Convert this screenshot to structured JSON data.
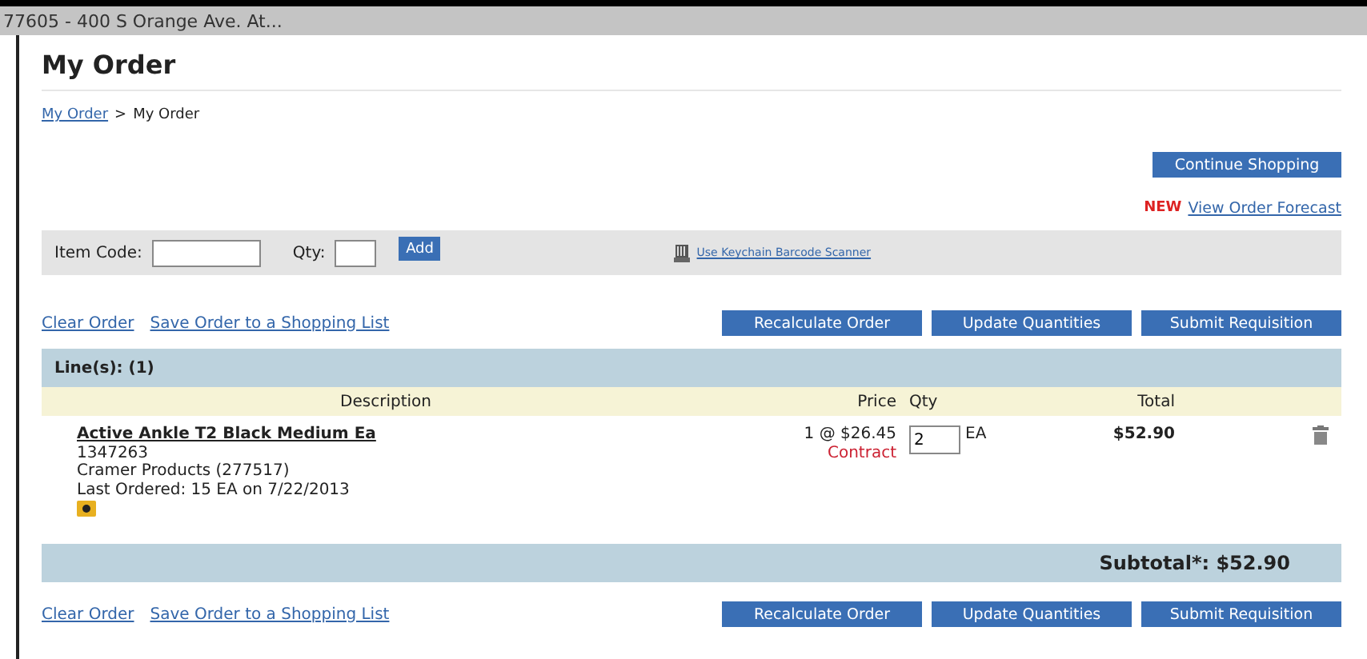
{
  "location_bar": {
    "text": "77605 - 400 S Orange Ave. At..."
  },
  "page": {
    "title": "My Order",
    "breadcrumb": {
      "link": "My Order",
      "separator": ">",
      "current": "My Order"
    }
  },
  "continue_button": "Continue Shopping",
  "forecast": {
    "badge": "NEW",
    "link": "View Order Forecast"
  },
  "quick_add": {
    "item_code_label": "Item Code:",
    "qty_label": "Qty:",
    "add_button": "Add",
    "scanner_link": "Use Keychain Barcode Scanner"
  },
  "top_actions": {
    "links": [
      "Clear Order",
      "Save Order to a Shopping List"
    ],
    "buttons": [
      "Recalculate Order",
      "Update Quantities",
      "Submit Requisition"
    ]
  },
  "table": {
    "lines_label": "Line(s): (1)",
    "columns": [
      "Description",
      "Price",
      "Qty",
      "Total"
    ],
    "rows": [
      {
        "name": "Active Ankle T2 Black Medium Ea",
        "code": "1347263",
        "vendor": "Cramer Products (277517)",
        "last_ordered": "Last Ordered: 15 EA on 7/22/2013",
        "price": "1 @ $26.45",
        "price_type": "Contract",
        "qty": "2",
        "unit": "EA",
        "total": "$52.90"
      }
    ],
    "subtotal": "Subtotal*: $52.90"
  },
  "bottom_actions": {
    "links": [
      "Clear Order",
      "Save Order to a Shopping List"
    ],
    "buttons": [
      "Recalculate Order",
      "Update Quantities",
      "Submit Requisition"
    ]
  }
}
